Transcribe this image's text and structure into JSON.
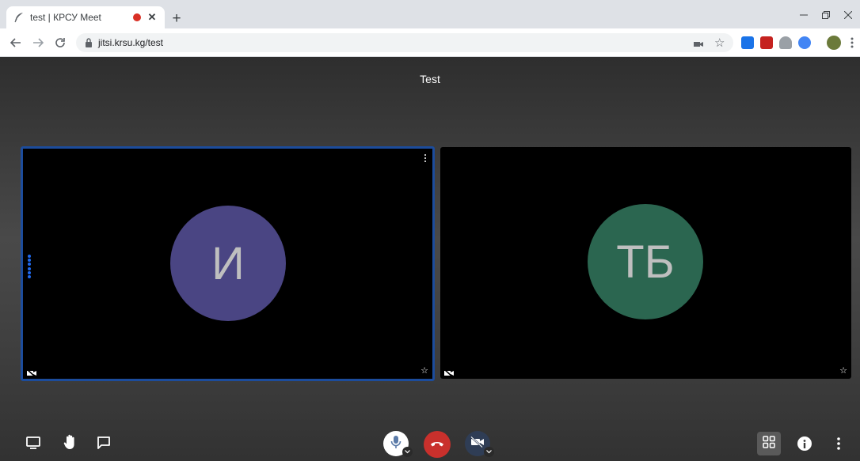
{
  "browser": {
    "tab_title": "test | КРСУ Meet",
    "url": "jitsi.krsu.kg/test",
    "new_tab_label": "+"
  },
  "meeting": {
    "title": "Test",
    "participants": [
      {
        "initials": "И",
        "avatar_color": "#4a4583",
        "active_speaker": true
      },
      {
        "initials": "ТБ",
        "avatar_color": "#2b6650",
        "active_speaker": false
      }
    ]
  },
  "colors": {
    "hangup": "#c9302c",
    "active_border": "#1c4c9c",
    "recording_dot": "#d93025"
  },
  "icons": {
    "left_controls": [
      "screen-share-icon",
      "raise-hand-icon",
      "chat-icon"
    ],
    "center_controls": [
      "microphone-icon",
      "hangup-icon",
      "camera-off-icon"
    ],
    "right_controls": [
      "tile-view-icon",
      "info-icon",
      "more-icon"
    ]
  }
}
